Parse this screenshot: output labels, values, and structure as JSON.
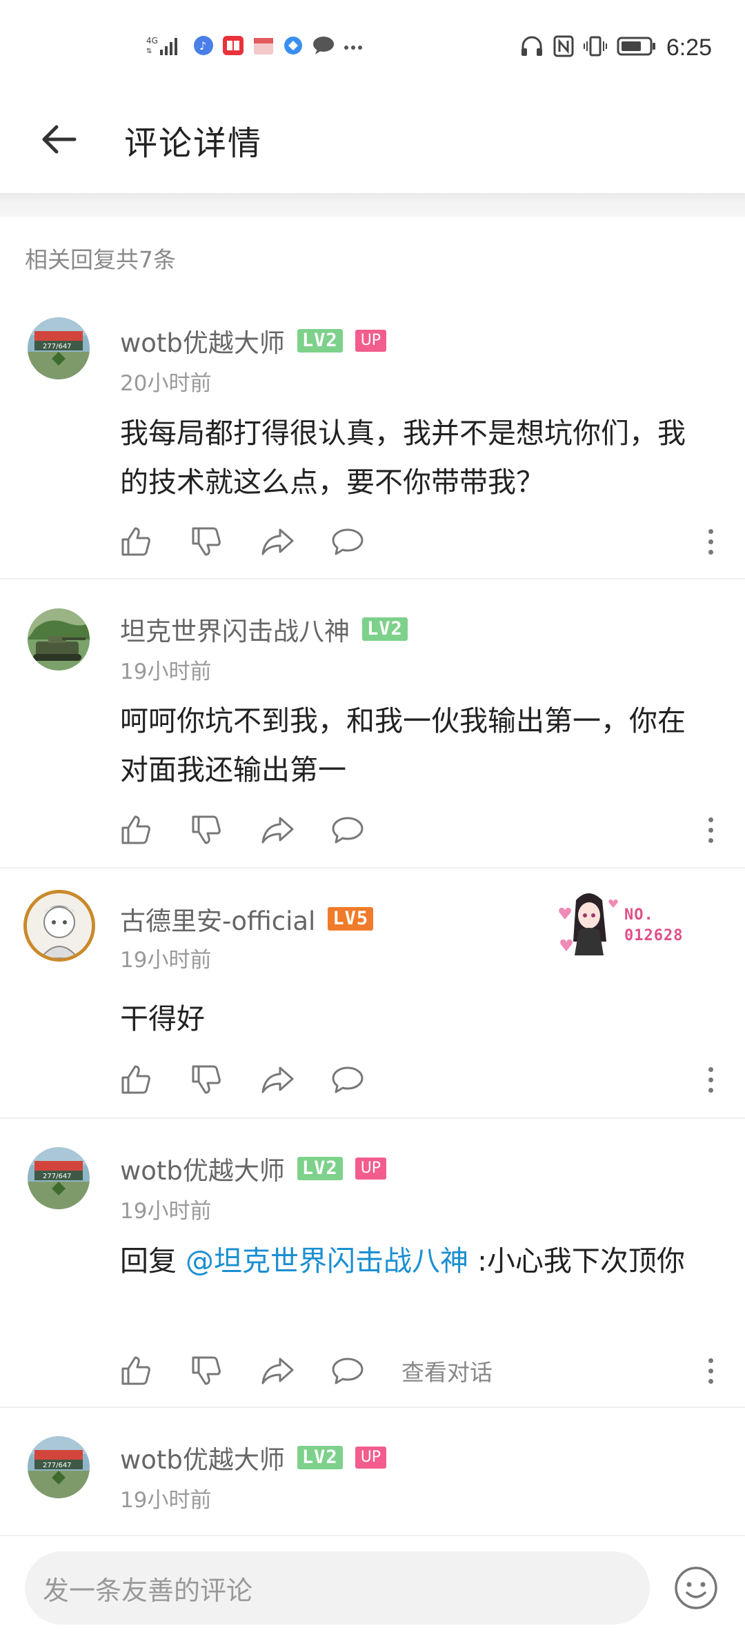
{
  "status_bar": {
    "network": "4G",
    "time": "6:25",
    "icons": [
      "signal-icon",
      "music-icon",
      "red-app-icon",
      "box-app-icon",
      "blue-app-icon",
      "chat-bubble-icon",
      "more-dots-icon",
      "headphones-icon",
      "nfc-icon",
      "vibrate-icon",
      "battery-icon"
    ]
  },
  "header": {
    "title": "评论详情",
    "back_icon": "back-arrow-icon"
  },
  "reply_count_label": "相关回复共7条",
  "colors": {
    "level_green": "#7dd18a",
    "level_orange": "#f07b2a",
    "up_pink": "#f25d8e",
    "mention_blue": "#1a8fd1"
  },
  "comments": [
    {
      "username": "wotb优越大师",
      "level": "LV2",
      "up_badge": "UP",
      "time": "20小时前",
      "content": "我每局都打得很认真，我并不是想坑你们，我的技术就这么点，要不你带带我？"
    },
    {
      "username": "坦克世界闪击战八神",
      "level": "LV2",
      "time": "19小时前",
      "content": "呵呵你坑不到我，和我一伙我输出第一，你在对面我还输出第一"
    },
    {
      "username": "古德里安-official",
      "level": "LV5",
      "time": "19小时前",
      "content": "干得好",
      "pendant_no_label": "NO.",
      "pendant_number": "012628"
    },
    {
      "username": "wotb优越大师",
      "level": "LV2",
      "up_badge": "UP",
      "time": "19小时前",
      "reply_prefix": "回复 ",
      "mention": "@坦克世界闪击战八神",
      "content": " :小心我下次顶你",
      "view_conversation": "查看对话"
    },
    {
      "username": "wotb优越大师",
      "level": "LV2",
      "up_badge": "UP",
      "time": "19小时前"
    }
  ],
  "bottom_bar": {
    "input_placeholder": "发一条友善的评论",
    "emoji_icon": "emoji-icon"
  }
}
